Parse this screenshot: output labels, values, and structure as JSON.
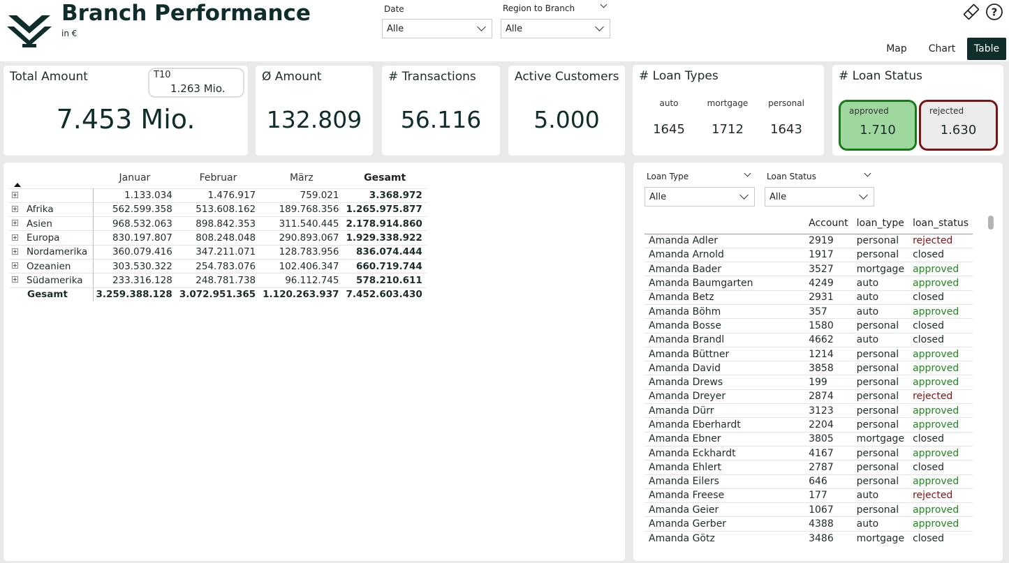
{
  "header": {
    "title": "Branch Performance",
    "subtitle": "in €",
    "filters": [
      {
        "label": "Date",
        "value": "Alle"
      },
      {
        "label": "Region to Branch",
        "value": "Alle"
      }
    ],
    "nav": [
      "Map",
      "Chart",
      "Table"
    ],
    "active_nav": "Table",
    "icons": [
      "eraser-icon",
      "help-icon"
    ]
  },
  "cards": {
    "total_amount": {
      "title": "Total Amount",
      "value": "7.453 Mio.",
      "t10_label": "T10",
      "t10_value": "1.263 Mio."
    },
    "avg_amount": {
      "title": "Ø Amount",
      "value": "132.809"
    },
    "transactions": {
      "title": "# Transactions",
      "value": "56.116"
    },
    "active_customers": {
      "title": "Active Customers",
      "value": "5.000"
    },
    "loan_types": {
      "title": "# Loan Types",
      "items": [
        {
          "label": "auto",
          "value": "1645"
        },
        {
          "label": "mortgage",
          "value": "1712"
        },
        {
          "label": "personal",
          "value": "1643"
        }
      ]
    },
    "loan_status": {
      "title": "# Loan Status",
      "items": [
        {
          "label": "approved",
          "value": "1.710",
          "color": "#9fd89f",
          "border": "#167a16"
        },
        {
          "label": "rejected",
          "value": "1.630",
          "color": "#ececec",
          "border": "#7a1414"
        }
      ]
    }
  },
  "matrix": {
    "columns": [
      "Januar",
      "Februar",
      "März",
      "Gesamt"
    ],
    "rows": [
      {
        "name": "",
        "values": [
          "1.133.034",
          "1.476.917",
          "759.021",
          "3.368.972"
        ]
      },
      {
        "name": "Afrika",
        "values": [
          "562.599.358",
          "513.608.162",
          "189.768.356",
          "1.265.975.877"
        ]
      },
      {
        "name": "Asien",
        "values": [
          "968.532.063",
          "898.842.353",
          "311.540.445",
          "2.178.914.860"
        ]
      },
      {
        "name": "Europa",
        "values": [
          "830.197.807",
          "808.248.048",
          "290.893.067",
          "1.929.338.922"
        ]
      },
      {
        "name": "Nordamerika",
        "values": [
          "360.079.416",
          "347.211.071",
          "128.783.956",
          "836.074.444"
        ]
      },
      {
        "name": "Ozeanien",
        "values": [
          "303.530.322",
          "254.783.076",
          "102.406.347",
          "660.719.744"
        ]
      },
      {
        "name": "Südamerika",
        "values": [
          "233.316.128",
          "248.781.738",
          "96.112.745",
          "578.210.611"
        ]
      }
    ],
    "total": {
      "name": "Gesamt",
      "values": [
        "3.259.388.128",
        "3.072.951.365",
        "1.120.263.937",
        "7.452.603.430"
      ]
    }
  },
  "details": {
    "filters": [
      {
        "label": "Loan Type",
        "value": "Alle"
      },
      {
        "label": "Loan Status",
        "value": "Alle"
      }
    ],
    "columns": [
      "",
      "Account",
      "loan_type",
      "loan_status"
    ],
    "rows": [
      [
        "Amanda Adler",
        "2919",
        "personal",
        "rejected"
      ],
      [
        "Amanda Arnold",
        "1917",
        "personal",
        "closed"
      ],
      [
        "Amanda Bader",
        "3527",
        "mortgage",
        "approved"
      ],
      [
        "Amanda Baumgarten",
        "4249",
        "auto",
        "approved"
      ],
      [
        "Amanda Betz",
        "2931",
        "auto",
        "closed"
      ],
      [
        "Amanda Böhm",
        "357",
        "auto",
        "approved"
      ],
      [
        "Amanda Bosse",
        "1580",
        "personal",
        "closed"
      ],
      [
        "Amanda Brandl",
        "4662",
        "auto",
        "closed"
      ],
      [
        "Amanda Büttner",
        "1214",
        "personal",
        "approved"
      ],
      [
        "Amanda David",
        "3858",
        "personal",
        "approved"
      ],
      [
        "Amanda Drews",
        "199",
        "personal",
        "approved"
      ],
      [
        "Amanda Dreyer",
        "2874",
        "personal",
        "rejected"
      ],
      [
        "Amanda Dürr",
        "3123",
        "personal",
        "approved"
      ],
      [
        "Amanda Eberhardt",
        "2204",
        "personal",
        "approved"
      ],
      [
        "Amanda Ebner",
        "3805",
        "mortgage",
        "closed"
      ],
      [
        "Amanda Eckhardt",
        "4167",
        "personal",
        "approved"
      ],
      [
        "Amanda Ehlert",
        "2787",
        "personal",
        "closed"
      ],
      [
        "Amanda Eilers",
        "646",
        "personal",
        "approved"
      ],
      [
        "Amanda Freese",
        "177",
        "auto",
        "rejected"
      ],
      [
        "Amanda Geier",
        "1067",
        "personal",
        "approved"
      ],
      [
        "Amanda Gerber",
        "4388",
        "auto",
        "approved"
      ],
      [
        "Amanda Götz",
        "3486",
        "mortgage",
        "closed"
      ]
    ]
  }
}
